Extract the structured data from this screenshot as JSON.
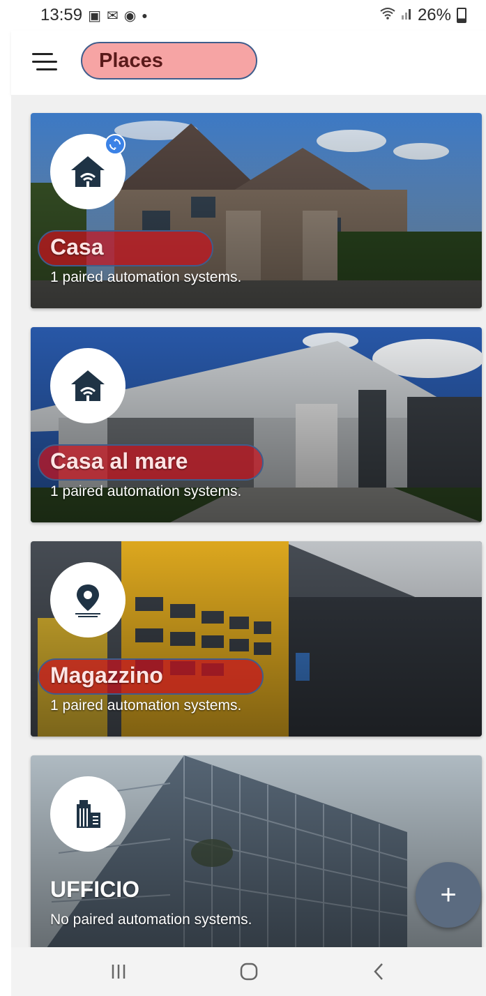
{
  "status_bar": {
    "time": "13:59",
    "battery": "26%",
    "icons_left": [
      "image-icon",
      "email-icon",
      "sync-circle-icon",
      "dot-icon"
    ],
    "icons_right": [
      "wifi-icon",
      "signal-icon",
      "battery-icon"
    ]
  },
  "app_bar": {
    "title": "Places",
    "menu_icon": "menu-icon"
  },
  "places": [
    {
      "name": "Casa",
      "subtitle": "1 paired automation systems.",
      "icon": "home-wifi-icon",
      "synced": true
    },
    {
      "name": "Casa al mare",
      "subtitle": "1 paired automation systems.",
      "icon": "home-wifi-icon",
      "synced": false
    },
    {
      "name": "Magazzino",
      "subtitle": "1 paired automation systems.",
      "icon": "location-pin-icon",
      "synced": false
    },
    {
      "name": "UFFICIO",
      "subtitle": "No paired automation systems.",
      "icon": "office-building-icon",
      "synced": false
    }
  ],
  "fab": {
    "label": "+"
  },
  "colors": {
    "highlight_red": "#c8141e",
    "title_pill": "#f6a4a4",
    "outline_blue": "#3f5d8c",
    "fab": "#5b6b80",
    "icon_dark": "#1f3345"
  }
}
